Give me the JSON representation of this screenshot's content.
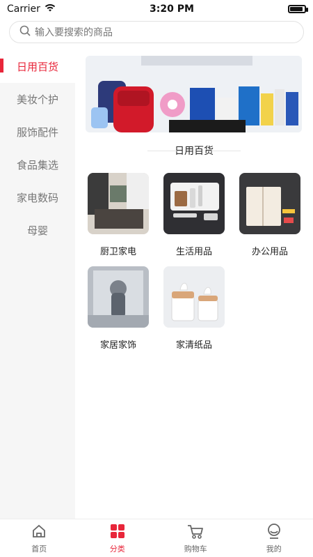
{
  "status": {
    "carrier": "Carrier",
    "time": "3:20 PM"
  },
  "search": {
    "placeholder": "输入要搜索的商品"
  },
  "sidebar": {
    "items": [
      {
        "label": "日用百货",
        "active": true
      },
      {
        "label": "美妆个护"
      },
      {
        "label": "服饰配件"
      },
      {
        "label": "食品集选"
      },
      {
        "label": "家电数码"
      },
      {
        "label": "母婴"
      }
    ]
  },
  "main": {
    "section_title": "日用百货",
    "categories": [
      {
        "label": "厨卫家电"
      },
      {
        "label": "生活用品"
      },
      {
        "label": "办公用品"
      },
      {
        "label": "家居家饰"
      },
      {
        "label": "家清纸品"
      }
    ]
  },
  "tabs": [
    {
      "label": "首页"
    },
    {
      "label": "分类",
      "active": true
    },
    {
      "label": "购物车"
    },
    {
      "label": "我的"
    }
  ],
  "colors": {
    "accent": "#e8263a",
    "sidebar_bg": "#f6f6f6"
  }
}
